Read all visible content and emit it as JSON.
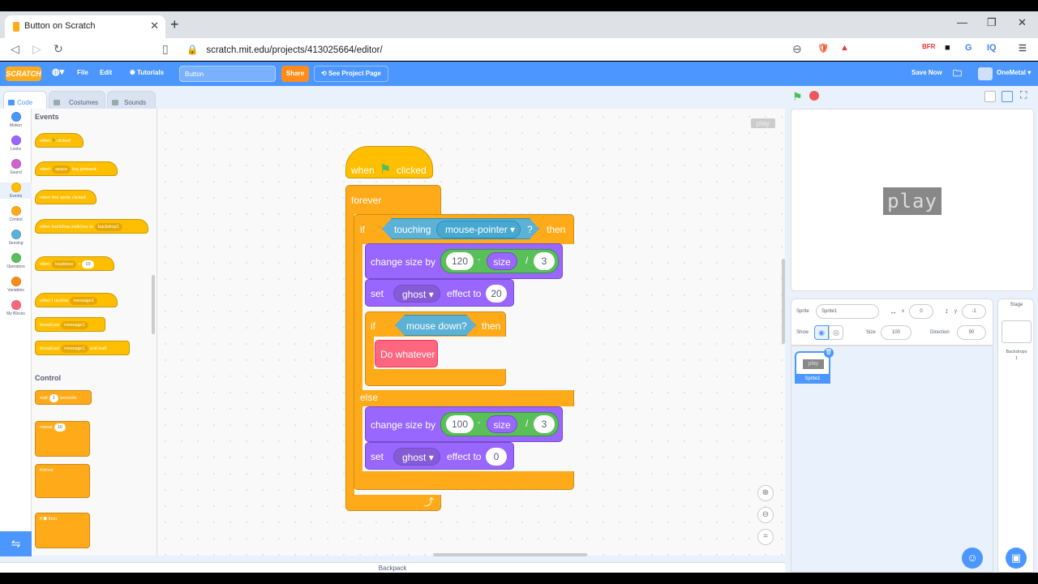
{
  "browser": {
    "tab_title": "Button on Scratch",
    "url": "scratch.mit.edu/projects/413025664/editor/"
  },
  "menu": {
    "logo": "SCRATCH",
    "file": "File",
    "edit": "Edit",
    "tutorials": "Tutorials",
    "project_title": "Button",
    "share": "Share",
    "see_project": "See Project Page",
    "save_now": "Save Now",
    "user": "OneMetal"
  },
  "editor_tabs": {
    "code": "Code",
    "costumes": "Costumes",
    "sounds": "Sounds"
  },
  "categories": [
    {
      "label": "Motion",
      "color": "#4c97ff"
    },
    {
      "label": "Looks",
      "color": "#9966ff"
    },
    {
      "label": "Sound",
      "color": "#cf63cf"
    },
    {
      "label": "Events",
      "color": "#ffbf00"
    },
    {
      "label": "Control",
      "color": "#ffab19"
    },
    {
      "label": "Sensing",
      "color": "#5cb1d6"
    },
    {
      "label": "Operators",
      "color": "#59c059"
    },
    {
      "label": "Variables",
      "color": "#ff8c1a"
    },
    {
      "label": "My Blocks",
      "color": "#ff6680"
    }
  ],
  "palette": {
    "events_heading": "Events",
    "control_heading": "Control",
    "when_flag": "when",
    "when_flag_clicked": "clicked",
    "when_key": "when",
    "key_space": "space",
    "key_pressed": "key pressed",
    "when_sprite_clicked": "when this sprite clicked",
    "when_backdrop": "when backdrop switches to",
    "backdrop1": "backdrop1",
    "when_loudness": "when",
    "loudness": "loudness",
    "gt": ">",
    "loud_val": "10",
    "when_receive": "when I receive",
    "message1": "message1",
    "broadcast": "broadcast",
    "broadcast_wait": "broadcast",
    "and_wait": "and wait",
    "wait": "wait",
    "wait_val": "1",
    "seconds": "seconds",
    "repeat": "repeat",
    "repeat_val": "10",
    "forever": "forever",
    "if": "if",
    "then": "then"
  },
  "workspace": {
    "thumb": "play",
    "hat_when": "when",
    "hat_clicked": "clicked",
    "forever": "forever",
    "if1": "if",
    "touching": "touching",
    "mouse_pointer": "mouse-pointer",
    "q": "?",
    "then1": "then",
    "change_size": "change size by",
    "n120": "120",
    "minus": "-",
    "size": "size",
    "div": "/",
    "n3": "3",
    "set": "set",
    "ghost": "ghost",
    "effect_to": "effect to",
    "n20": "20",
    "if2": "if",
    "mouse_down": "mouse down?",
    "then2": "then",
    "do_whatever": "Do whatever",
    "else": "else",
    "change_size2": "change size by",
    "n100": "100",
    "minus2": "-",
    "size2": "size",
    "div2": "/",
    "n3b": "3",
    "set2": "set",
    "ghost2": "ghost",
    "effect_to2": "effect to",
    "n0": "0",
    "backpack": "Backpack"
  },
  "stage": {
    "sprite_text": "play"
  },
  "sprite_info": {
    "sprite_label": "Sprite",
    "sprite_name": "Sprite1",
    "x_label": "x",
    "x_val": "0",
    "y_label": "y",
    "y_val": "-1",
    "show_label": "Show",
    "size_label": "Size",
    "size_val": "100",
    "direction_label": "Direction",
    "direction_val": "90",
    "thumb_name": "Sprite1",
    "thumb_text": "play"
  },
  "stage_panel": {
    "title": "Stage",
    "backdrops_label": "Backdrops",
    "backdrops_count": "1"
  }
}
